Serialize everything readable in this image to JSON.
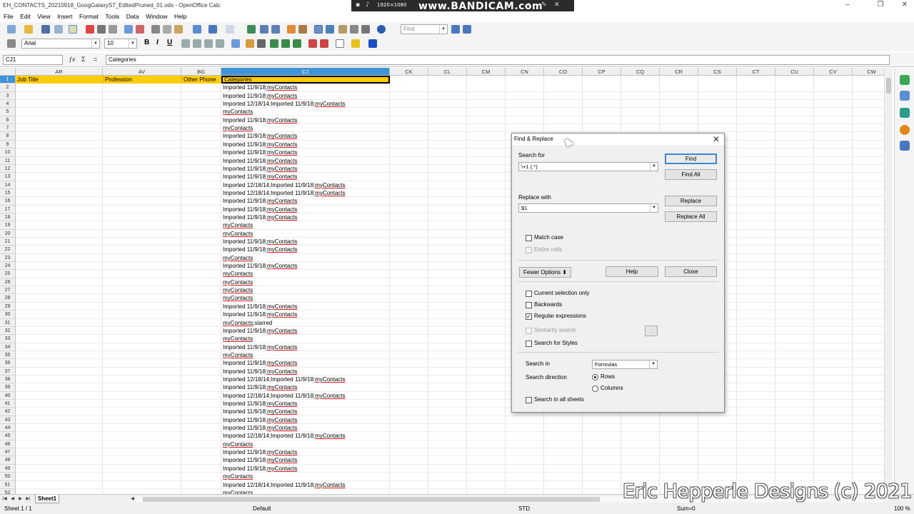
{
  "window": {
    "title": "EH_CONTACTS_20210918_GoogGalaxyS7_EditedPruned_01.ods - OpenOffice Calc"
  },
  "recorder": {
    "logo": "www.BANDICAM.com",
    "resolution": "1920×1080"
  },
  "menu": [
    "File",
    "Edit",
    "View",
    "Insert",
    "Format",
    "Tools",
    "Data",
    "Window",
    "Help"
  ],
  "toolbar": {
    "find_placeholder": "Find",
    "font_name": "Arial",
    "font_size": "10",
    "bold": "B",
    "italic": "I",
    "underline": "U"
  },
  "formula_bar": {
    "cell_ref": "CJ1",
    "content": "Categories"
  },
  "columns": {
    "AR": {
      "label": "AR",
      "header_value": "Job Title"
    },
    "AV": {
      "label": "AV",
      "header_value": "Profession"
    },
    "BG": {
      "label": "BG",
      "header_value": "Other Phone"
    },
    "CJ": {
      "label": "CJ",
      "header_value": "Categories"
    },
    "empty": [
      "CK",
      "CL",
      "CM",
      "CN",
      "CO",
      "CP",
      "CQ",
      "CR",
      "CS",
      "CT",
      "CU",
      "CV",
      "CW"
    ]
  },
  "rows": [
    {
      "n": "2",
      "prefix": "Imported 11/9/18;",
      "tag": "myContacts"
    },
    {
      "n": "3",
      "prefix": "Imported 11/9/18;",
      "tag": "myContacts"
    },
    {
      "n": "4",
      "prefix": "Imported 12/18/14;Imported 11/9/18;",
      "tag": "myContacts"
    },
    {
      "n": "5",
      "prefix": "",
      "tag": "myContacts"
    },
    {
      "n": "6",
      "prefix": "Imported 11/9/18;",
      "tag": "myContacts"
    },
    {
      "n": "7",
      "prefix": "",
      "tag": "myContacts"
    },
    {
      "n": "8",
      "prefix": "Imported 11/9/18;",
      "tag": "myContacts"
    },
    {
      "n": "9",
      "prefix": "Imported 11/9/18;",
      "tag": "myContacts"
    },
    {
      "n": "10",
      "prefix": "Imported 11/9/18;",
      "tag": "myContacts"
    },
    {
      "n": "11",
      "prefix": "Imported 11/9/18;",
      "tag": "myContacts"
    },
    {
      "n": "12",
      "prefix": "Imported 11/9/18;",
      "tag": "myContacts"
    },
    {
      "n": "13",
      "prefix": "Imported 11/9/18;",
      "tag": "myContacts"
    },
    {
      "n": "14",
      "prefix": "Imported 12/18/14;Imported 11/9/18;",
      "tag": "myContacts"
    },
    {
      "n": "15",
      "prefix": "Imported 12/18/14;Imported 11/9/18;",
      "tag": "myContacts"
    },
    {
      "n": "16",
      "prefix": "Imported 11/9/18;",
      "tag": "myContacts"
    },
    {
      "n": "17",
      "prefix": "Imported 11/9/18;",
      "tag": "myContacts"
    },
    {
      "n": "18",
      "prefix": "Imported 11/9/18;",
      "tag": "myContacts"
    },
    {
      "n": "19",
      "prefix": "",
      "tag": "myContacts"
    },
    {
      "n": "20",
      "prefix": "",
      "tag": "myContacts"
    },
    {
      "n": "21",
      "prefix": "Imported 11/9/18;",
      "tag": "myContacts"
    },
    {
      "n": "22",
      "prefix": "Imported 11/9/18;",
      "tag": "myContacts"
    },
    {
      "n": "23",
      "prefix": "",
      "tag": "myContacts"
    },
    {
      "n": "24",
      "prefix": "Imported 11/9/18;",
      "tag": "myContacts"
    },
    {
      "n": "25",
      "prefix": "",
      "tag": "myContacts"
    },
    {
      "n": "26",
      "prefix": "",
      "tag": "myContacts"
    },
    {
      "n": "27",
      "prefix": "",
      "tag": "myContacts"
    },
    {
      "n": "28",
      "prefix": "",
      "tag": "myContacts"
    },
    {
      "n": "29",
      "prefix": "Imported 11/9/18;",
      "tag": "myContacts"
    },
    {
      "n": "30",
      "prefix": "Imported 11/9/18;",
      "tag": "myContacts"
    },
    {
      "n": "31",
      "prefix": "",
      "tag": "myContacts",
      "suffix": ";starred"
    },
    {
      "n": "32",
      "prefix": "Imported 11/9/18;",
      "tag": "myContacts"
    },
    {
      "n": "33",
      "prefix": "",
      "tag": "myContacts"
    },
    {
      "n": "34",
      "prefix": "Imported 11/9/18;",
      "tag": "myContacts"
    },
    {
      "n": "35",
      "prefix": "",
      "tag": "myContacts"
    },
    {
      "n": "36",
      "prefix": "Imported 11/9/18;",
      "tag": "myContacts"
    },
    {
      "n": "37",
      "prefix": "Imported 11/9/18;",
      "tag": "myContacts"
    },
    {
      "n": "38",
      "prefix": "Imported 12/18/14;Imported 11/9/18;",
      "tag": "myContacts"
    },
    {
      "n": "39",
      "prefix": "Imported 11/9/18;",
      "tag": "myContacts"
    },
    {
      "n": "40",
      "prefix": "Imported 12/18/14;Imported 11/9/18;",
      "tag": "myContacts"
    },
    {
      "n": "41",
      "prefix": "Imported 11/9/18;",
      "tag": "myContacts"
    },
    {
      "n": "42",
      "prefix": "Imported 11/9/18;",
      "tag": "myContacts"
    },
    {
      "n": "43",
      "prefix": "Imported 11/9/18;",
      "tag": "myContacts"
    },
    {
      "n": "44",
      "prefix": "Imported 11/9/18;",
      "tag": "myContacts"
    },
    {
      "n": "45",
      "prefix": "Imported 12/18/14;Imported 11/9/18;",
      "tag": "myContacts"
    },
    {
      "n": "46",
      "prefix": "",
      "tag": "myContacts"
    },
    {
      "n": "47",
      "prefix": "Imported 11/9/18;",
      "tag": "myContacts"
    },
    {
      "n": "48",
      "prefix": "Imported 11/9/18;",
      "tag": "myContacts"
    },
    {
      "n": "49",
      "prefix": "Imported 11/9/18;",
      "tag": "myContacts"
    },
    {
      "n": "50",
      "prefix": "",
      "tag": "myContacts"
    },
    {
      "n": "51",
      "prefix": "Imported 12/18/14;Imported 11/9/18;",
      "tag": "myContacts"
    },
    {
      "n": "52",
      "prefix": "",
      "tag": "myContacts"
    }
  ],
  "first_row_number": "1",
  "sheet": {
    "tab": "Sheet1",
    "status_sheet": "Sheet 1 / 1",
    "page_style": "Default",
    "mode": "STD",
    "sum": "Sum=0",
    "zoom": "100 %"
  },
  "dialog": {
    "title": "Find & Replace",
    "search_for_label": "Search for",
    "search_for_value": "\\+1 (.*)",
    "replace_with_label": "Replace with",
    "replace_with_value": "$1",
    "find": "Find",
    "find_all": "Find All",
    "replace": "Replace",
    "replace_all": "Replace All",
    "match_case": "Match case",
    "entire_cells": "Entire cells",
    "fewer_options": "Fewer Options",
    "help": "Help",
    "close": "Close",
    "current_selection_only": "Current selection only",
    "backwards": "Backwards",
    "regular_expressions": "Regular expressions",
    "similarity_search": "Similarity search",
    "similarity_button": "...",
    "search_for_styles": "Search for Styles",
    "search_in_label": "Search in",
    "search_in_value": "Formulas",
    "search_direction_label": "Search direction",
    "rows": "Rows",
    "columns": "Columns",
    "search_all_sheets": "Search in all sheets",
    "regular_expressions_checked": true,
    "rows_selected": true
  },
  "watermark": "Eric Hepperle Designs (c) 2021"
}
